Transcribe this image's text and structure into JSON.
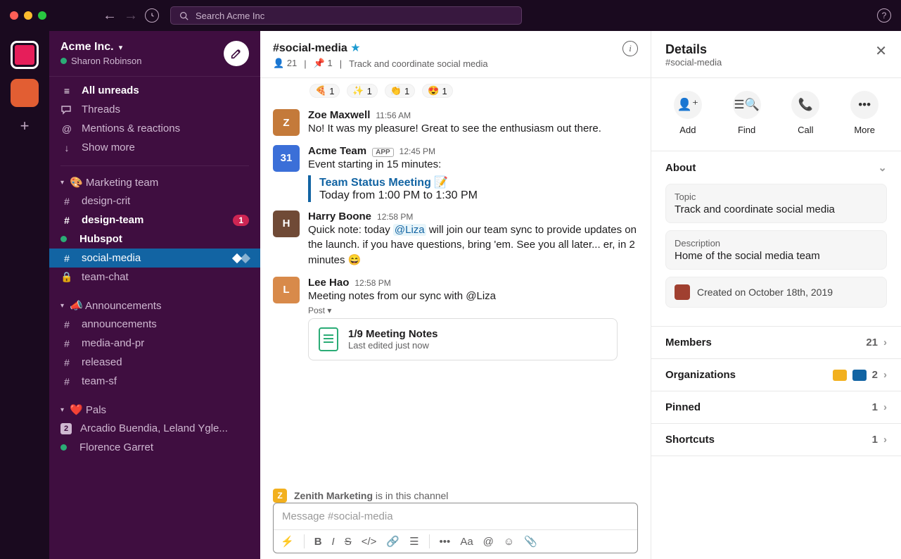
{
  "titlebar": {
    "search_placeholder": "Search Acme Inc"
  },
  "workspace": {
    "name": "Acme Inc.",
    "user": "Sharon Robinson"
  },
  "sidebar": {
    "nav": {
      "unreads": "All unreads",
      "threads": "Threads",
      "mentions": "Mentions & reactions",
      "more": "Show more"
    },
    "sections": [
      {
        "title": "Marketing team",
        "emoji": "🎨",
        "items": [
          {
            "prefix": "#",
            "label": "design-crit",
            "bold": false
          },
          {
            "prefix": "#",
            "label": "design-team",
            "bold": true,
            "badge": "1"
          },
          {
            "prefix": "●",
            "label": "Hubspot",
            "bold": true,
            "dot": true
          },
          {
            "prefix": "#",
            "label": "social-media",
            "bold": false,
            "active": true
          },
          {
            "prefix": "🔒",
            "label": "team-chat",
            "bold": false
          }
        ]
      },
      {
        "title": "Announcements",
        "emoji": "📣",
        "items": [
          {
            "prefix": "#",
            "label": "announcements"
          },
          {
            "prefix": "#",
            "label": "media-and-pr"
          },
          {
            "prefix": "#",
            "label": "released"
          },
          {
            "prefix": "#",
            "label": "team-sf"
          }
        ]
      },
      {
        "title": "Pals",
        "emoji": "❤️",
        "items": [
          {
            "prefix": "2",
            "label": "Arcadio Buendia, Leland Ygle...",
            "square": true
          },
          {
            "prefix": "●",
            "label": "Florence Garret",
            "dot": true
          }
        ]
      }
    ]
  },
  "channel": {
    "name": "#social-media",
    "members": "21",
    "pinned": "1",
    "topic": "Track and coordinate social media",
    "reactions": [
      {
        "emoji": "🍕",
        "count": "1"
      },
      {
        "emoji": "✨",
        "count": "1"
      },
      {
        "emoji": "👏",
        "count": "1"
      },
      {
        "emoji": "😍",
        "count": "1"
      }
    ],
    "messages": [
      {
        "author": "Zoe Maxwell",
        "time": "11:56 AM",
        "avatar_bg": "#c47a3a",
        "initial": "Z",
        "body": "No! It was my pleasure! Great to see the enthusiasm out there."
      },
      {
        "author": "Acme Team",
        "app": "APP",
        "time": "12:45 PM",
        "avatar_bg": "#3b6fd8",
        "initial": "31",
        "body": "Event starting in 15 minutes:",
        "event": {
          "title": "Team Status Meeting",
          "emoji": "📝",
          "when": "Today from 1:00 PM to 1:30 PM"
        }
      },
      {
        "author": "Harry Boone",
        "time": "12:58 PM",
        "avatar_bg": "#704a36",
        "initial": "H",
        "body_pre": "Quick note: today ",
        "mention": "@Liza",
        "body_post": " will join our team sync to provide updates on the launch. if you have questions, bring 'em. See you all later... er, in 2 minutes 😄"
      },
      {
        "author": "Lee Hao",
        "time": "12:58 PM",
        "avatar_bg": "#d88a4a",
        "initial": "L",
        "body": "Meeting notes from our sync with @Liza",
        "post_label": "Post ▾",
        "doc": {
          "title": "1/9 Meeting Notes",
          "sub": "Last edited just now"
        }
      }
    ],
    "ext_org": "Zenith Marketing",
    "ext_text": "is in this channel",
    "compose_placeholder": "Message #social-media"
  },
  "details": {
    "title": "Details",
    "subtitle": "#social-media",
    "actions": {
      "add": "Add",
      "find": "Find",
      "call": "Call",
      "more": "More"
    },
    "about": {
      "header": "About",
      "topic_lbl": "Topic",
      "topic": "Track and coordinate social media",
      "desc_lbl": "Description",
      "desc": "Home of the social media team",
      "created": "Created on October 18th, 2019"
    },
    "rows": {
      "members": {
        "label": "Members",
        "count": "21"
      },
      "orgs": {
        "label": "Organizations",
        "count": "2"
      },
      "pinned": {
        "label": "Pinned",
        "count": "1"
      },
      "shortcuts": {
        "label": "Shortcuts",
        "count": "1"
      }
    }
  }
}
